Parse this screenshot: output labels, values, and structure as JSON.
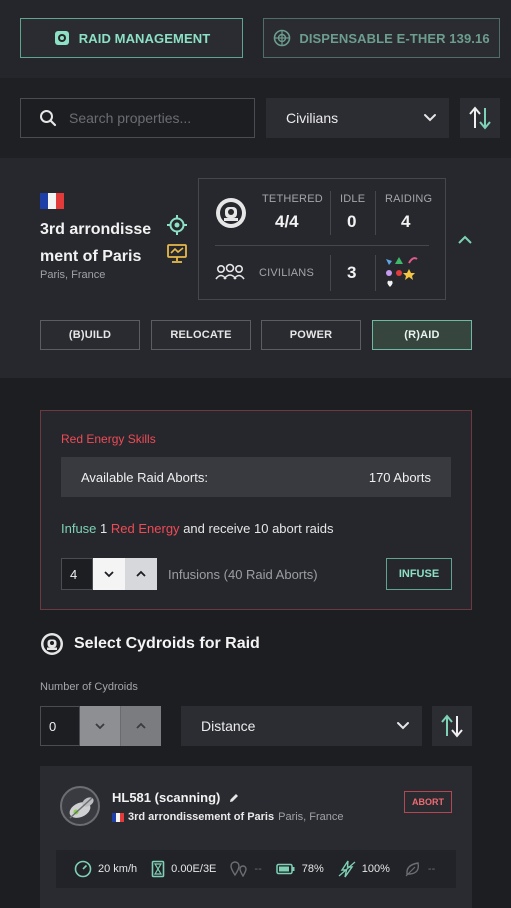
{
  "header": {
    "raid_management_label": "RAID MANAGEMENT",
    "dispensable_label": "DISPENSABLE E-THER 139.16"
  },
  "search": {
    "placeholder": "Search properties...",
    "filter_value": "Civilians"
  },
  "property": {
    "name": "3rd arrondissement of Paris",
    "name_line1": "3rd arrondisse",
    "name_line2": "ment of Paris",
    "location": "Paris, France",
    "stats": {
      "tethered_label": "TETHERED",
      "tethered_value": "4/4",
      "idle_label": "IDLE",
      "idle_value": "0",
      "raiding_label": "RAIDING",
      "raiding_value": "4",
      "civilians_label": "CIVILIANS",
      "civilians_value": "3"
    },
    "actions": [
      "(B)UILD",
      "RELOCATE",
      "POWER",
      "(R)AID"
    ]
  },
  "energy": {
    "title": "Red Energy Skills",
    "available_label": "Available Raid Aborts:",
    "available_value": "170 Aborts",
    "infuse_word": "Infuse",
    "infuse_amount": "1",
    "red_energy": "Red Energy",
    "infuse_rest": "and receive 10 abort raids",
    "stepper_value": "4",
    "infusions_text": "Infusions (40 Raid Aborts)",
    "infuse_button": "INFUSE"
  },
  "select_cydroids": {
    "title": "Select Cydroids for Raid",
    "number_label": "Number of Cydroids",
    "number_value": "0",
    "sort_value": "Distance"
  },
  "cydroid": {
    "name": "HL581 (scanning)",
    "property": "3rd arrondissement of Paris",
    "city": "Paris, France",
    "abort_label": "ABORT",
    "speed": "20 km/h",
    "cost": "0.00E/3E",
    "distance": "--",
    "battery": "78%",
    "power": "100%",
    "other": "--"
  },
  "colors": {
    "accent_green": "#7ed1b4",
    "accent_red": "#ef4b56",
    "background": "#1d1e22"
  },
  "icons": [
    "robot-eye-icon",
    "globe-icon",
    "search-icon",
    "chevron-down-icon",
    "sort-icon",
    "target-icon",
    "chart-icon",
    "robot-icon",
    "users-icon",
    "chevron-up-icon",
    "pencil-icon",
    "speedometer-icon",
    "hourglass-icon",
    "pins-icon",
    "battery-icon",
    "lightning-icon",
    "leaf-icon"
  ]
}
